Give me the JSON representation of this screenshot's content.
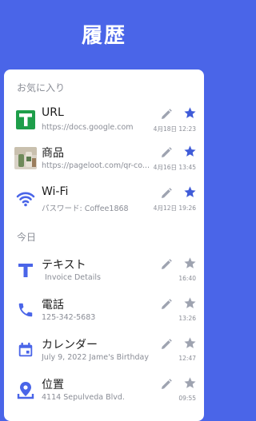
{
  "header": {
    "title": "履歴"
  },
  "sections": {
    "favorites_label": "お気に入り",
    "today_label": "今日"
  },
  "favorites": [
    {
      "title": "URL",
      "subtitle": "https://docs.google.com",
      "time": "4月18日 12:23",
      "icon": "google-sheets-icon",
      "starred": true
    },
    {
      "title": "商品",
      "subtitle": "https://pageloot.com/qr-co...",
      "time": "4月16日 13:45",
      "icon": "product-thumbnail",
      "starred": true
    },
    {
      "title": "Wi-Fi",
      "subtitle": "パスワード: Coffee1868",
      "time": "4月12日 19:26",
      "icon": "wifi-icon",
      "starred": true
    }
  ],
  "today": [
    {
      "title": "テキスト",
      "subtitle": "Invoice Details",
      "time": "16:40",
      "icon": "text-icon",
      "starred": false
    },
    {
      "title": "電話",
      "subtitle": "125-342-5683",
      "time": "13:26",
      "icon": "phone-icon",
      "starred": false
    },
    {
      "title": "カレンダー",
      "subtitle": "July 9, 2022 Jame's Birthday",
      "time": "12:47",
      "icon": "calendar-icon",
      "starred": false
    },
    {
      "title": "位置",
      "subtitle": "4114 Sepulveda Blvd.",
      "time": "09:55",
      "icon": "location-icon",
      "starred": false
    }
  ],
  "colors": {
    "accent": "#4a65e8",
    "star_active": "#3f5bd8",
    "star_inactive": "#9ea3b0",
    "muted_text": "#8a8d96"
  }
}
